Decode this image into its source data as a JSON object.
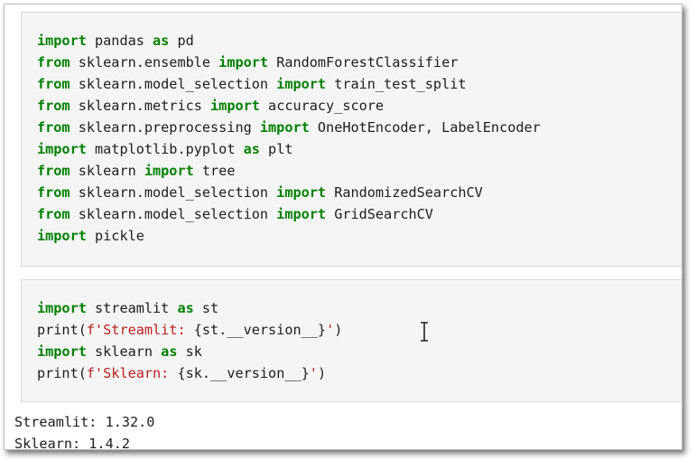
{
  "cell1": {
    "lines": [
      [
        [
          "kw",
          "import"
        ],
        [
          "t",
          " pandas "
        ],
        [
          "kw",
          "as"
        ],
        [
          "t",
          " pd"
        ]
      ],
      [
        [
          "kw",
          "from"
        ],
        [
          "t",
          " sklearn.ensemble "
        ],
        [
          "kw",
          "import"
        ],
        [
          "t",
          " RandomForestClassifier"
        ]
      ],
      [
        [
          "kw",
          "from"
        ],
        [
          "t",
          " sklearn.model_selection "
        ],
        [
          "kw",
          "import"
        ],
        [
          "t",
          " train_test_split"
        ]
      ],
      [
        [
          "kw",
          "from"
        ],
        [
          "t",
          " sklearn.metrics "
        ],
        [
          "kw",
          "import"
        ],
        [
          "t",
          " accuracy_score"
        ]
      ],
      [
        [
          "kw",
          "from"
        ],
        [
          "t",
          " sklearn.preprocessing "
        ],
        [
          "kw",
          "import"
        ],
        [
          "t",
          " OneHotEncoder, LabelEncoder"
        ]
      ],
      [
        [
          "kw",
          "import"
        ],
        [
          "t",
          " matplotlib.pyplot "
        ],
        [
          "kw",
          "as"
        ],
        [
          "t",
          " plt"
        ]
      ],
      [
        [
          "kw",
          "from"
        ],
        [
          "t",
          " sklearn "
        ],
        [
          "kw",
          "import"
        ],
        [
          "t",
          " tree"
        ]
      ],
      [
        [
          "kw",
          "from"
        ],
        [
          "t",
          " sklearn.model_selection "
        ],
        [
          "kw",
          "import"
        ],
        [
          "t",
          " RandomizedSearchCV"
        ]
      ],
      [
        [
          "kw",
          "from"
        ],
        [
          "t",
          " sklearn.model_selection "
        ],
        [
          "kw",
          "import"
        ],
        [
          "t",
          " GridSearchCV"
        ]
      ],
      [
        [
          "kw",
          "import"
        ],
        [
          "t",
          " pickle"
        ]
      ]
    ]
  },
  "cell2": {
    "lines": [
      [
        [
          "kw",
          "import"
        ],
        [
          "t",
          " streamlit "
        ],
        [
          "kw",
          "as"
        ],
        [
          "t",
          " st"
        ]
      ],
      [
        [
          "t",
          "print("
        ],
        [
          "str",
          "f'Streamlit: "
        ],
        [
          "t",
          "{st.__version__}"
        ],
        [
          "str",
          "'"
        ],
        [
          "t",
          ")"
        ]
      ],
      [
        [
          "kw",
          "import"
        ],
        [
          "t",
          " sklearn "
        ],
        [
          "kw",
          "as"
        ],
        [
          "t",
          " sk"
        ]
      ],
      [
        [
          "t",
          "print("
        ],
        [
          "str",
          "f'Sklearn: "
        ],
        [
          "t",
          "{sk.__version__}"
        ],
        [
          "str",
          "'"
        ],
        [
          "t",
          ")"
        ]
      ]
    ]
  },
  "output": {
    "lines": [
      "Streamlit: 1.32.0",
      "Sklearn: 1.4.2"
    ]
  },
  "colors": {
    "keyword": "#008000",
    "string": "#ba2121",
    "text": "#1d1d1d",
    "cell_bg": "#f5f5f5"
  },
  "icons": {
    "cursor": "text-cursor-ibeam-icon"
  }
}
